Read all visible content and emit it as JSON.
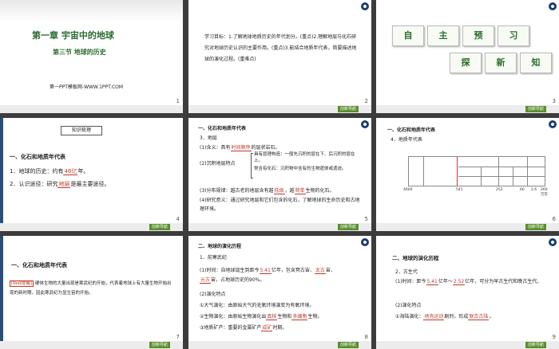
{
  "s1": {
    "title": "第一章  宇宙中的地球",
    "subtitle": "第三节    地球的历史",
    "site": "第一PPT模板网-WWW.1PPT.COM",
    "num": "1"
  },
  "s2": {
    "text": "学习目标：1.了解地球地质历史的年代划分。(重点)2.理解地层与化石研究对地球历史认识的主要作用。(重点)3.能结合地质年代表，简要描述地球的演化过程。(重难点)",
    "num": "2"
  },
  "s3": {
    "cards1": [
      "自",
      "主",
      "预",
      "习"
    ],
    "cards2": [
      "探",
      "新",
      "知"
    ],
    "num": "3"
  },
  "s4": {
    "box": "知识梳理",
    "h": "一、化石和地质年代表",
    "l1a": "1．地球的历史：约有",
    "l1b": "46亿",
    "l1c": "年。",
    "l2a": "2．认识途径：研究",
    "l2b": "地层",
    "l2c": "是最主要途径。",
    "num": "4"
  },
  "s5": {
    "h": "一、化石和地质年代表",
    "h2": "3．地层",
    "a1": "(1)含义：具有",
    "a1b": "时间顺序",
    "a1c": "的层状岩石。",
    "b0": "(2)沉积地层特点",
    "b1": "具有层理构造：一般先沉积的层在下、后沉积的层在上。",
    "b2": "常含有化石：沉积物中含有的生物遗体或遗迹。",
    "c1": "(3)分布规律：越古老的地层含有越",
    "c1b": "低级",
    "c1c": "，越",
    "c1d": "简单",
    "c1e": "生物的化石。",
    "d1": "(4)研究意义：通过研究地层和它们包含的化石，了解地球的生命历史和古地理环境。",
    "num": "5"
  },
  "s6": {
    "h": "一、化石和地质年代表",
    "h2": "4．地质年代表",
    "ticks": [
      "4600",
      "541",
      "252",
      "66",
      "2.6",
      "260万年"
    ],
    "num": "6"
  },
  "s7": {
    "h": "一、化石和地质年代表",
    "tag": "[特别提醒]",
    "text": "硬体生物的大量出现是寒武纪的开始，代表着地球上有大量生物开始出现的新时期，因此寒武纪为显生宙的开始。",
    "num": "7"
  },
  "s8": {
    "h": "二、地球的演化历程",
    "h2": "1．前寒武纪",
    "a1": "(1)时间：自地球诞生到距今",
    "a1b": "5.41",
    "a1c": "亿年，包含冥古宙、",
    "a1d": "太古",
    "a1e": "宙、",
    "a2b": "元古",
    "a2c": "宙，占地球历史的90%。",
    "b0": "(2)演化特点",
    "b1": "①大气演化：由原始大气的无氧环境演变为有氧环境。",
    "b2a": "②生物演化：由原始生物演化出",
    "b2b": "真核",
    "b2c": "生物和",
    "b2d": "多细胞",
    "b2e": "生物。",
    "b3a": "③地质矿产：重要的金属矿产",
    "b3b": "成矿",
    "b3c": "时期。",
    "num": "8"
  },
  "s9": {
    "h": "二、地球的演化历程",
    "h2": "2．古生代",
    "a1": "(1)时间：距今",
    "a1b": "5.41",
    "a1c": "亿年～",
    "a1d": "2.52",
    "a1e": "亿年，可分为早古生代和晚古生代。",
    "b0": "(2)演化特点",
    "b1a": "①海陆演化：",
    "b1b": "地壳运动",
    "b1c": "剧烈，形成",
    "b1d": "联合古陆",
    "b1e": "。",
    "num": "9"
  },
  "badge": "创新导航"
}
